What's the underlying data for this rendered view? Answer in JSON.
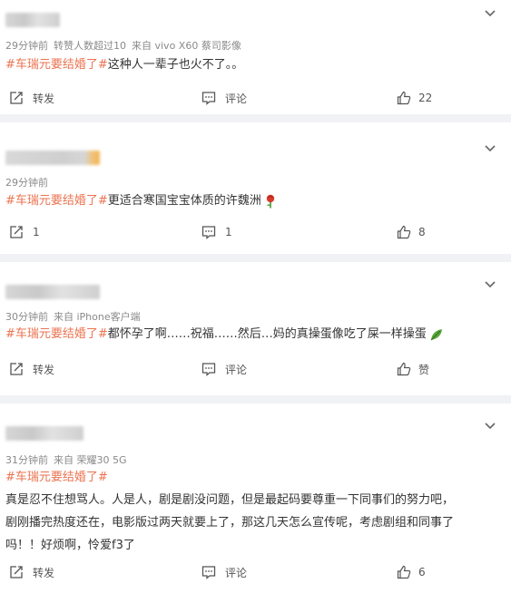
{
  "posts": [
    {
      "time": "29分钟前",
      "meta": "转赞人数超过10",
      "source": "来自 vivo X60 蔡司影像",
      "tag": "#车瑞元要结婚了#",
      "body": "这种人一辈子也火不了。。",
      "share": "转发",
      "comment": "评论",
      "like": "22"
    },
    {
      "time": "29分钟前",
      "tag": "#车瑞元要结婚了#",
      "body": "更适合寒国宝宝体质的许魏洲",
      "emoji": "rose-icon",
      "share": "1",
      "comment": "1",
      "like": "8"
    },
    {
      "time": "30分钟前",
      "source": "来自 iPhone客户端",
      "tag": "#车瑞元要结婚了#",
      "body": "都怀孕了啊……祝福……然后…妈的真操蛋像吃了屎一样操蛋",
      "emoji": "leaf-icon",
      "share": "转发",
      "comment": "评论",
      "like": "赞"
    },
    {
      "time": "31分钟前",
      "source": "来自 荣耀30 5G",
      "tag": "#车瑞元要结婚了#",
      "line1": "真是忍不住想骂人。人是人，剧是剧没问题，但是最起码要尊重一下同事们的努力吧，",
      "line2": "剧刚播完热度还在，电影版过两天就要上了，那这几天怎么宣传呢，考虑剧组和同事了",
      "line3": "吗！！好烦啊，怜爱f3了",
      "share": "转发",
      "comment": "评论",
      "like": "6"
    }
  ],
  "colors": {
    "tag": "#eb7350",
    "meta": "#8a8a8a",
    "divider": "#f1f2f5"
  }
}
